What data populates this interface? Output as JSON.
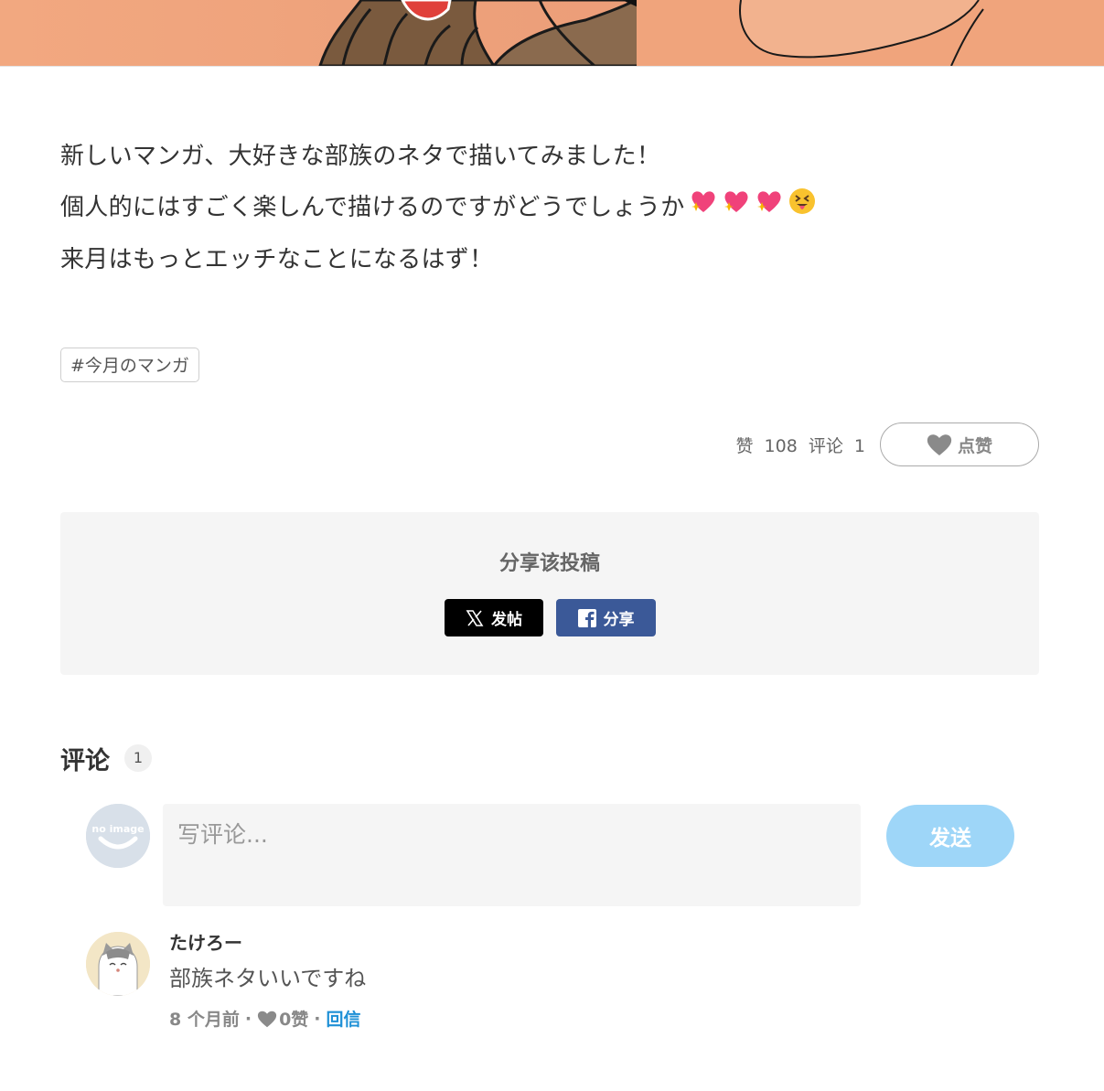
{
  "post": {
    "lines": [
      "新しいマンガ、大好きな部族のネタで描いてみました！",
      "個人的にはすごく楽しんで描けるのですがどうでしょうか",
      "来月はもっとエッチなことになるはず！"
    ],
    "line2_emojis": [
      "sparkling-heart-icon",
      "sparkling-heart-icon",
      "sparkling-heart-icon",
      "squinting-tongue-face-icon"
    ],
    "tag": "#今月のマンガ"
  },
  "stats": {
    "likes_label": "赞",
    "likes_count": "108",
    "comments_label": "评论",
    "comments_count": "1",
    "like_button_label": "点赞"
  },
  "share": {
    "title": "分享该投稿",
    "x_label": "发帖",
    "facebook_label": "分享"
  },
  "comments": {
    "heading": "评论",
    "count": "1",
    "input_placeholder": "写评论...",
    "send_label": "发送",
    "avatar_placeholder_text": "no image",
    "items": [
      {
        "author": "たけろー",
        "text": "部族ネタいいですね",
        "time": "8 个月前",
        "likes": "0赞",
        "reply_label": "回信"
      }
    ]
  },
  "colors": {
    "banner": "#eb9d78",
    "share_x": "#000000",
    "share_facebook": "#3b5998",
    "send_button": "#9ed6f8",
    "reply_link": "#1e90d6"
  }
}
